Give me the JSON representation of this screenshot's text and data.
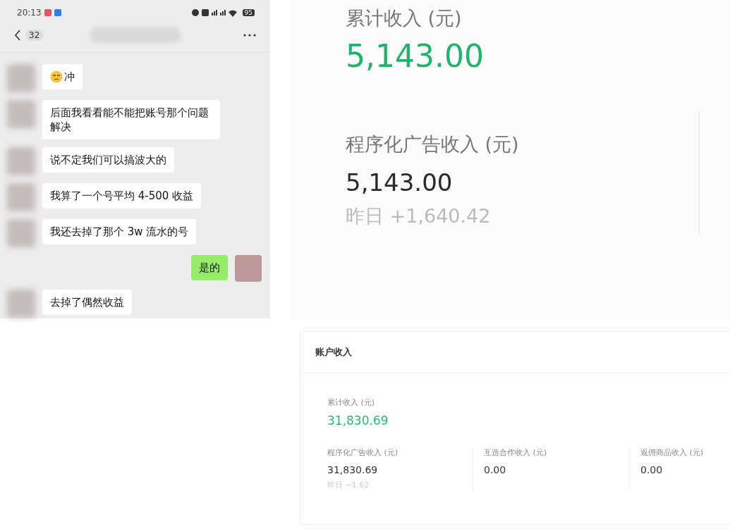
{
  "chat": {
    "status_bar": {
      "time": "20:13",
      "battery": "95"
    },
    "header": {
      "unread": "32"
    },
    "messages": [
      {
        "kind": "in",
        "text": "冲",
        "emoji": true
      },
      {
        "kind": "in",
        "text": "后面我看看能不能把账号那个问题解决",
        "emoji": false
      },
      {
        "kind": "in",
        "text": "说不定我们可以搞波大的",
        "emoji": false
      },
      {
        "kind": "in",
        "text": "我算了一个号平均 4-500 收益",
        "emoji": false
      },
      {
        "kind": "in",
        "text": "我还去掉了那个 3w 流水的号",
        "emoji": false
      },
      {
        "kind": "out",
        "text": "是的",
        "emoji": false
      },
      {
        "kind": "in",
        "text": "去掉了偶然收益",
        "emoji": false
      }
    ]
  },
  "zoomed_income": {
    "total_label": "累计收入 (元)",
    "total_value": "5,143.00",
    "ad_label": "程序化广告收入 (元)",
    "ad_value": "5,143.00",
    "yesterday_label": "昨日",
    "yesterday_value": "+1,640.42"
  },
  "account_income": {
    "title": "账户收入",
    "total_label": "累计收入 (元)",
    "total_value": "31,830.69",
    "columns": [
      {
        "label": "程序化广告收入 (元)",
        "value": "31,830.69",
        "yesterday": "昨日 −1.62"
      },
      {
        "label": "互选合作收入 (元)",
        "value": "0.00"
      },
      {
        "label": "返佣商品收入 (元)",
        "value": "0.00"
      }
    ]
  }
}
